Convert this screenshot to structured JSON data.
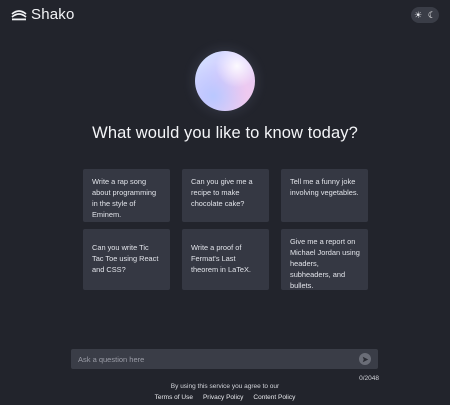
{
  "header": {
    "brand_name": "Shako",
    "theme_toggle": {
      "light_icon": "sun-icon",
      "dark_icon": "moon-icon",
      "mode": "dark"
    }
  },
  "hero": {
    "headline": "What would you like to know today?"
  },
  "prompts": [
    {
      "text": "Write a rap song about programming in the style of Eminem."
    },
    {
      "text": "Can you give me a recipe to make chocolate cake?"
    },
    {
      "text": "Tell me a funny joke involving vegetables."
    },
    {
      "text": "Can you write Tic Tac Toe using React and CSS?"
    },
    {
      "text": "Write a proof of Fermat's Last theorem in LaTeX."
    },
    {
      "text": "Give me a report on Michael Jordan using headers, subheaders, and bullets."
    }
  ],
  "composer": {
    "placeholder": "Ask a question here",
    "value": "",
    "char_count": "0/2048",
    "send_icon": "send-icon"
  },
  "footer": {
    "note": "By using this service you agree to our",
    "links": [
      "Terms of Use",
      "Privacy Policy",
      "Content Policy"
    ]
  },
  "colors": {
    "background": "#22242c",
    "card": "#353843",
    "input": "#3a3d47",
    "text": "#e9eaee"
  }
}
